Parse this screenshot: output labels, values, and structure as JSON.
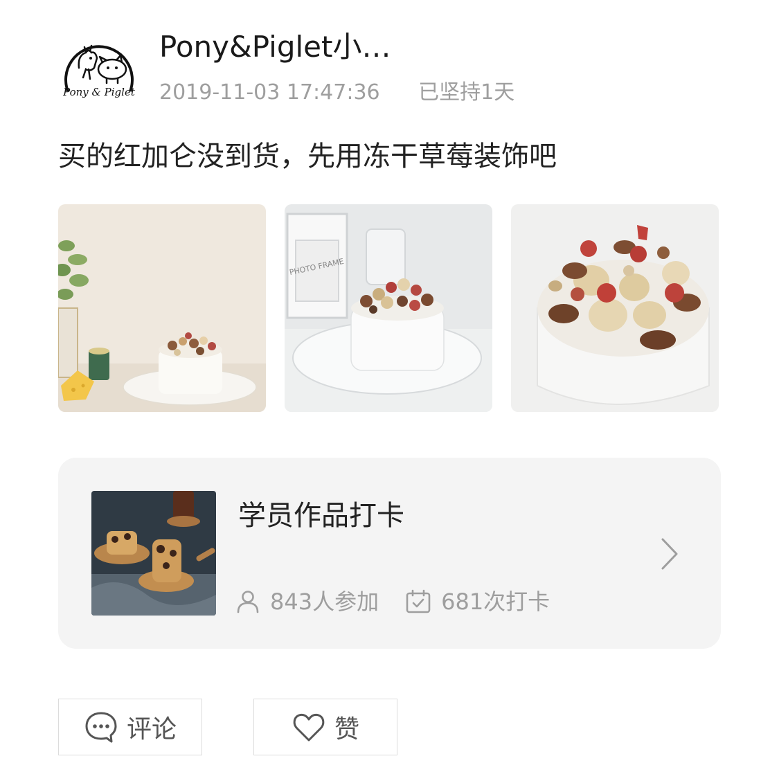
{
  "post": {
    "author": {
      "name": "Pony&Piglet小…",
      "avatar_logo_text": "Pony & Piglet"
    },
    "timestamp": "2019-11-03 17:47:36",
    "streak": "已坚持1天",
    "text": "买的红加仑没到货，先用冻干草莓装饰吧",
    "photo_frame_text": "PHOTO FRAME"
  },
  "activity": {
    "title": "学员作品打卡",
    "participants": "843人参加",
    "checkins": "681次打卡"
  },
  "actions": {
    "comment_label": "评论",
    "like_label": "赞"
  },
  "icons": {
    "participants": "person-icon",
    "checkins": "calendar-check-icon",
    "open": "chevron-right-icon",
    "comment": "chat-bubble-icon",
    "like": "heart-icon"
  },
  "colors": {
    "text_primary": "#222222",
    "text_secondary": "#9e9e9e",
    "card_background": "#f4f4f4",
    "button_border": "#dcdcdc"
  }
}
